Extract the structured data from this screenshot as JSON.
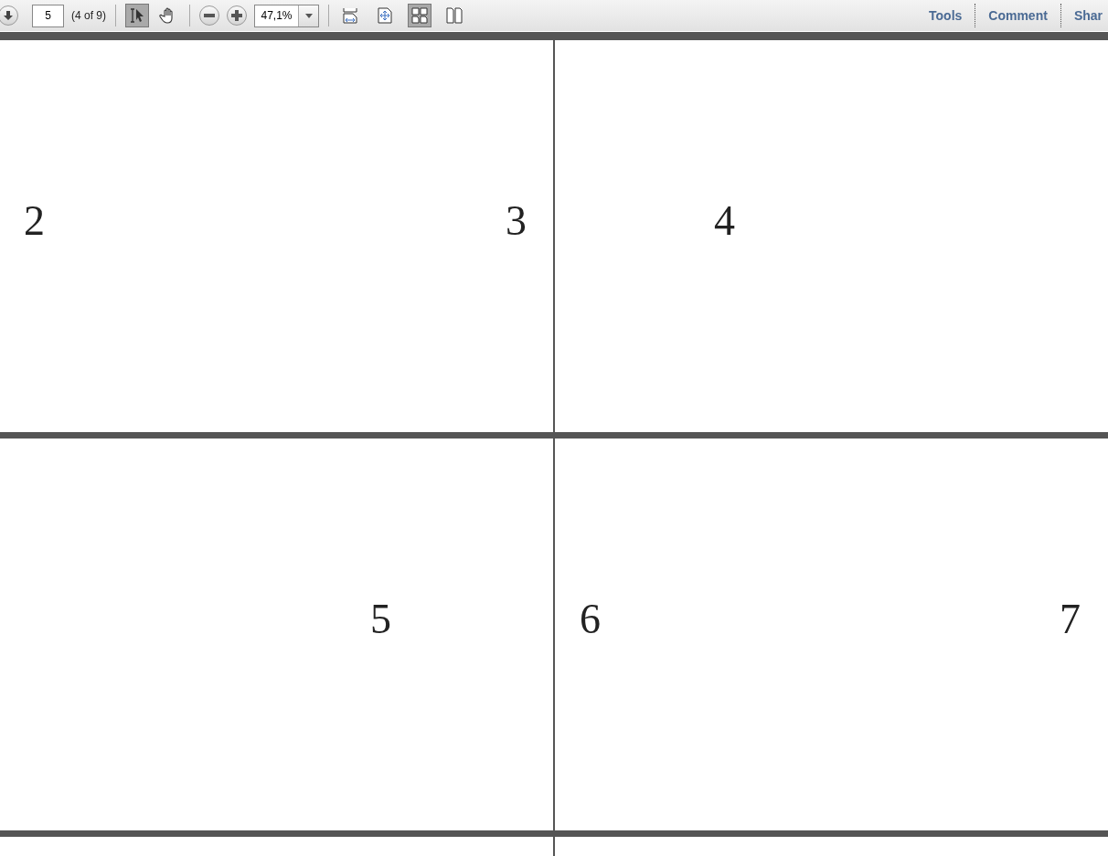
{
  "toolbar": {
    "page_field": {
      "value": "5"
    },
    "page_count": "(4 of 9)",
    "tools": [
      {
        "kind": "select",
        "selected": true
      },
      {
        "kind": "hand",
        "selected": false
      }
    ],
    "zoom_field": {
      "value": "47,1%"
    },
    "views": [
      {
        "kind": "scroll",
        "selected": false
      },
      {
        "kind": "fit",
        "selected": false
      },
      {
        "kind": "two-page",
        "selected": true
      },
      {
        "kind": "two-up",
        "selected": false
      }
    ],
    "panes": [
      "Tools",
      "Comment",
      "Shar"
    ]
  },
  "pages": [
    {
      "numbers": [
        "2",
        "3"
      ]
    },
    {
      "numbers": [
        "4"
      ]
    },
    {
      "numbers": [
        "5"
      ]
    },
    {
      "numbers": [
        "6",
        "7"
      ]
    }
  ]
}
